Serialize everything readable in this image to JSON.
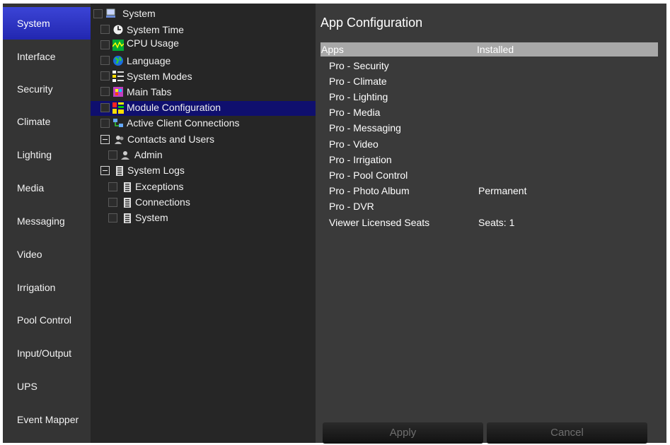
{
  "nav": {
    "items": [
      {
        "label": "System",
        "active": true
      },
      {
        "label": "Interface"
      },
      {
        "label": "Security"
      },
      {
        "label": "Climate"
      },
      {
        "label": "Lighting"
      },
      {
        "label": "Media"
      },
      {
        "label": "Messaging"
      },
      {
        "label": "Video"
      },
      {
        "label": "Irrigation"
      },
      {
        "label": "Pool Control"
      },
      {
        "label": "Input/Output"
      },
      {
        "label": "UPS"
      },
      {
        "label": "Event Mapper"
      }
    ]
  },
  "tree": {
    "items": [
      {
        "label": "System",
        "icon": "computer-icon"
      },
      {
        "label": "System Time",
        "icon": "clock-icon"
      },
      {
        "label": "CPU Usage",
        "icon": "cpu-graph-icon"
      },
      {
        "label": "Language",
        "icon": "globe-icon"
      },
      {
        "label": "System Modes",
        "icon": "modes-icon"
      },
      {
        "label": "Main Tabs",
        "icon": "tabs-icon"
      },
      {
        "label": "Module Configuration",
        "icon": "module-icon",
        "selected": true
      },
      {
        "label": "Active Client Connections",
        "icon": "network-icon"
      },
      {
        "label": "Contacts and Users",
        "icon": "users-icon",
        "expanded": true
      },
      {
        "label": "Admin",
        "icon": "user-icon"
      },
      {
        "label": "System Logs",
        "icon": "log-icon",
        "expanded": true
      },
      {
        "label": "Exceptions",
        "icon": "log-icon"
      },
      {
        "label": "Connections",
        "icon": "log-icon"
      },
      {
        "label": "System",
        "icon": "log-icon"
      }
    ]
  },
  "panel": {
    "title": "App Configuration",
    "col_apps": "Apps",
    "col_installed": "Installed",
    "apps": [
      {
        "name": "Pro - Security",
        "installed": ""
      },
      {
        "name": "Pro - Climate",
        "installed": ""
      },
      {
        "name": "Pro - Lighting",
        "installed": ""
      },
      {
        "name": "Pro - Media",
        "installed": ""
      },
      {
        "name": "Pro - Messaging",
        "installed": ""
      },
      {
        "name": "Pro - Video",
        "installed": ""
      },
      {
        "name": "Pro - Irrigation",
        "installed": ""
      },
      {
        "name": "Pro - Pool Control",
        "installed": ""
      },
      {
        "name": "Pro - Photo Album",
        "installed": "Permanent"
      },
      {
        "name": "Pro - DVR",
        "installed": ""
      },
      {
        "name": "Viewer Licensed Seats",
        "installed": "Seats: 1"
      }
    ],
    "apply_label": "Apply",
    "cancel_label": "Cancel"
  },
  "colors": {
    "nav_active": "#2a30c4",
    "tree_selected": "#0f0f6e",
    "header_bar": "#a8a8a8"
  }
}
